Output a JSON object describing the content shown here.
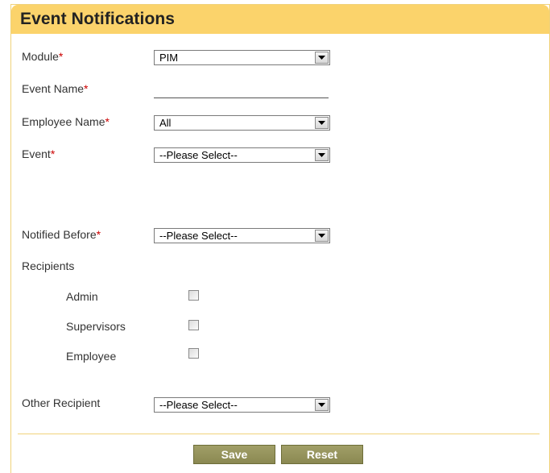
{
  "panel": {
    "title": "Event Notifications"
  },
  "form": {
    "module": {
      "label": "Module",
      "required_mark": "*",
      "value": "PIM"
    },
    "event_name": {
      "label": "Event Name",
      "required_mark": "*",
      "value": ""
    },
    "employee_name": {
      "label": "Employee Name",
      "required_mark": "*",
      "value": "All"
    },
    "event": {
      "label": "Event",
      "required_mark": "*",
      "value": "--Please Select--"
    },
    "notified_before": {
      "label": "Notified Before",
      "required_mark": "*",
      "value": "--Please Select--"
    },
    "recipients": {
      "label": "Recipients",
      "options": [
        {
          "label": "Admin",
          "checked": false
        },
        {
          "label": "Supervisors",
          "checked": false
        },
        {
          "label": "Employee",
          "checked": false
        }
      ]
    },
    "other_recipient": {
      "label": "Other Recipient",
      "value": "--Please Select--"
    }
  },
  "buttons": {
    "save_label": "Save",
    "reset_label": "Reset"
  },
  "colors": {
    "header_bg": "#fbd36b",
    "required_mark": "#cc0000",
    "button_bg": "#8f8d57",
    "border": "#f0d27a"
  },
  "icons": {
    "dropdown": "chevron-down-icon"
  }
}
